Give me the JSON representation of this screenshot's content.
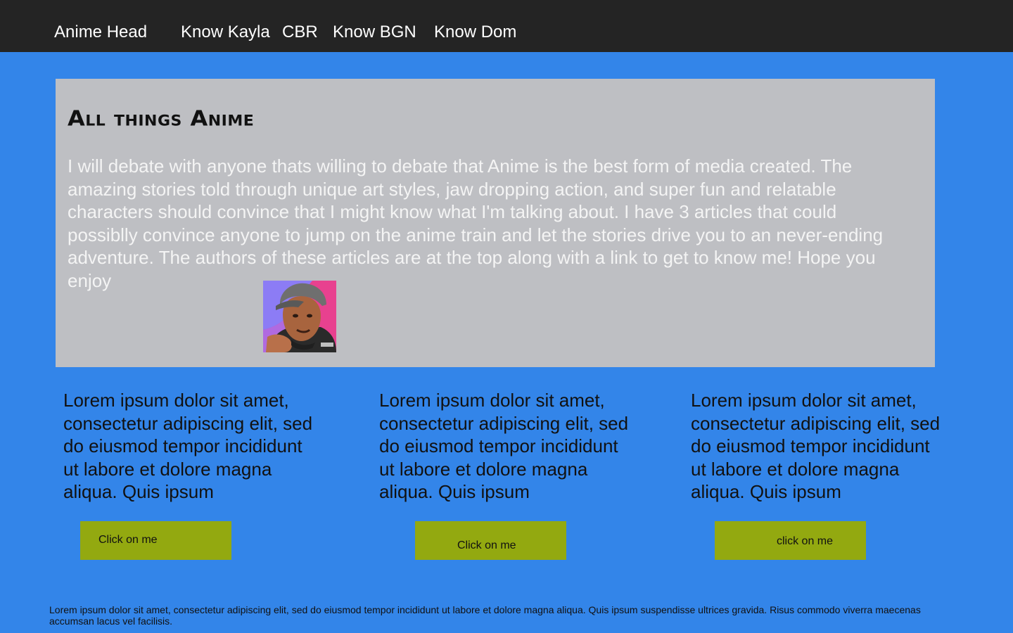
{
  "nav": {
    "brand": "Anime Head",
    "links": [
      "Know Kayla",
      "CBR",
      "Know BGN",
      "Know Dom"
    ]
  },
  "hero": {
    "title": "All things Anime",
    "text": "I will debate with anyone thats willing to debate that Anime is the best form of media created. The amazing stories told through unique art styles, jaw dropping action, and super fun and relatable characters should convince that I might know what I'm talking about. I have 3 articles that could possiblly convince anyone to jump on the anime train and let the stories drive you to an never-ending adventure. The authors of these articles are at the top along with a link to get to know me! Hope you enjoy",
    "avatar_icon": "cartoon-avatar-portrait"
  },
  "columns": [
    {
      "text": "Lorem ipsum dolor sit amet, consectetur adipiscing elit, sed do eiusmod tempor incididunt ut labore et dolore magna aliqua. Quis ipsum",
      "button_label": "Click on me"
    },
    {
      "text": "Lorem ipsum dolor sit amet, consectetur adipiscing elit, sed do eiusmod tempor incididunt ut labore et dolore magna aliqua. Quis ipsum",
      "button_label": "Click on me"
    },
    {
      "text": "Lorem ipsum dolor sit amet, consectetur adipiscing elit, sed do eiusmod tempor incididunt ut labore et dolore magna aliqua. Quis ipsum",
      "button_label": "click on me"
    }
  ],
  "footer": {
    "text": "Lorem ipsum dolor sit amet, consectetur adipiscing elit, sed do eiusmod tempor incididunt ut labore et dolore magna aliqua. Quis ipsum suspendisse ultrices gravida. Risus commodo viverra maecenas accumsan lacus vel facilisis."
  },
  "colors": {
    "page_background": "#3385e9",
    "nav_background": "#242424",
    "hero_background": "#bebfc3",
    "button_background": "#93a910"
  }
}
